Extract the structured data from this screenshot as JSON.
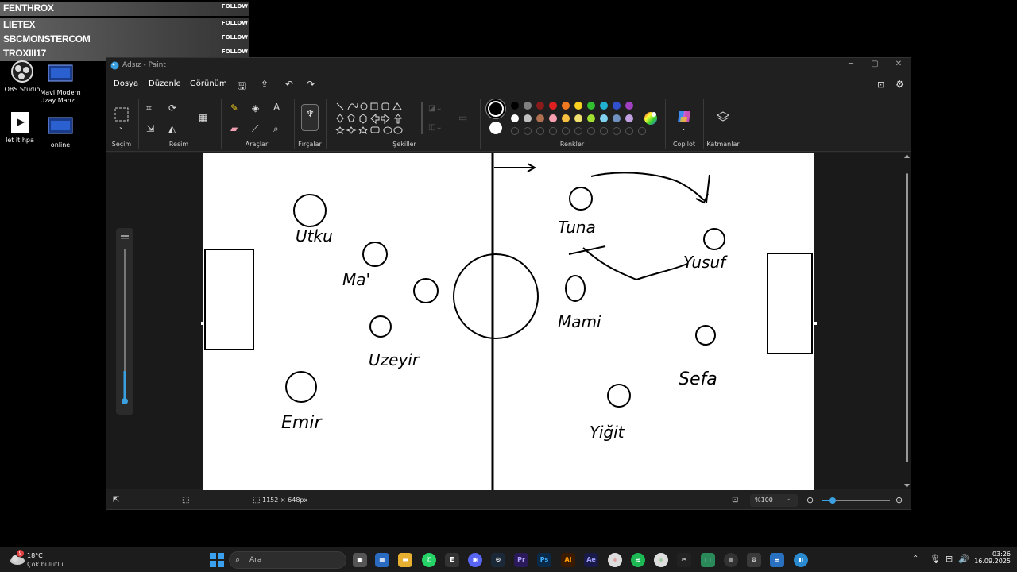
{
  "overlay": {
    "rows": [
      {
        "name": "FENTHROX",
        "follow": "FOLLOW"
      },
      {
        "name": "LIETEX",
        "follow": "FOLLOW"
      },
      {
        "name": "SBCMONSTERCOM",
        "follow": "FOLLOW"
      },
      {
        "name": "TROXIII17",
        "follow": "FOLLOW"
      }
    ]
  },
  "desktop_icons": [
    {
      "label": "OBS Studio"
    },
    {
      "label": "Mavi Modern Uzay Manz..."
    },
    {
      "label": "let it hpa"
    },
    {
      "label": "online"
    }
  ],
  "paint": {
    "title": "Adsız - Paint",
    "menus": [
      "Dosya",
      "Düzenle",
      "Görünüm"
    ],
    "groups": [
      "Seçim",
      "Resim",
      "Araçlar",
      "Fırçalar",
      "Şekiller",
      "Renkler",
      "Copilot",
      "Katmanlar"
    ],
    "palette_row1": [
      "#000000",
      "#808080",
      "#8b1a1a",
      "#e02020",
      "#f07820",
      "#f8d020",
      "#30c030",
      "#20b0d0",
      "#3050d0",
      "#a040c0"
    ],
    "palette_row2": [
      "#ffffff",
      "#c0c0c0",
      "#b07050",
      "#f8a0b0",
      "#f8c040",
      "#f0e070",
      "#a0e030",
      "#80d0f0",
      "#7090c0",
      "#c0a0e0"
    ],
    "status": {
      "dimensions": "1152 × 648px",
      "zoom": "%100"
    },
    "canvas_labels": [
      {
        "text": "Utku"
      },
      {
        "text": "Ma'"
      },
      {
        "text": "Uzeyir"
      },
      {
        "text": "Emir"
      },
      {
        "text": "Tuna"
      },
      {
        "text": "Yusuf"
      },
      {
        "text": "Mami"
      },
      {
        "text": "Sefa"
      },
      {
        "text": "Yiğit"
      }
    ]
  },
  "taskbar": {
    "weather": {
      "temp": "18°C",
      "desc": "Çok bulutlu",
      "badge": "9"
    },
    "search_placeholder": "Ara",
    "clock": {
      "time": "03:26",
      "date": "16.09.2025"
    }
  }
}
